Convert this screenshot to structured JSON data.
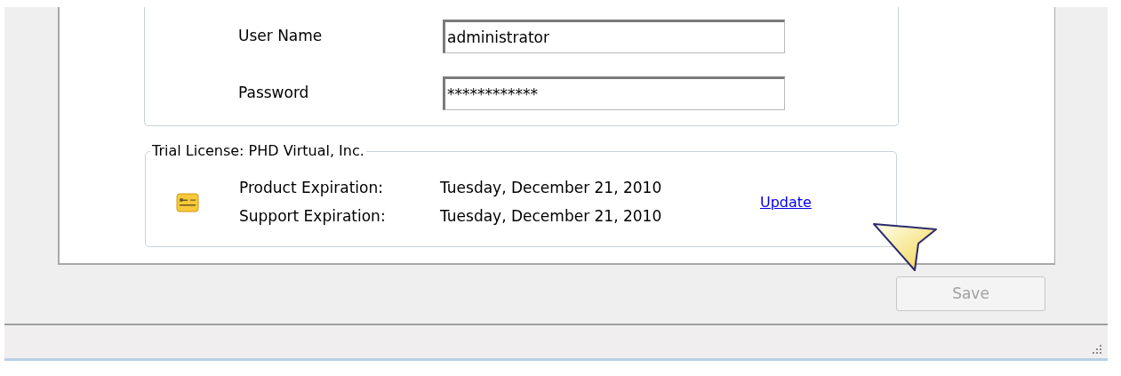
{
  "credentials": {
    "fields": [
      {
        "label": "User Name",
        "value": "administrator"
      },
      {
        "label": "Password",
        "value": "************"
      }
    ]
  },
  "license": {
    "title": "Trial License: PHD Virtual, Inc.",
    "rows": [
      {
        "label": "Product Expiration:",
        "value": "Tuesday, December 21, 2010"
      },
      {
        "label": "Support Expiration:",
        "value": "Tuesday, December 21, 2010"
      }
    ],
    "link": "Update"
  },
  "save_button": {
    "label": "Save",
    "disabled": true
  }
}
